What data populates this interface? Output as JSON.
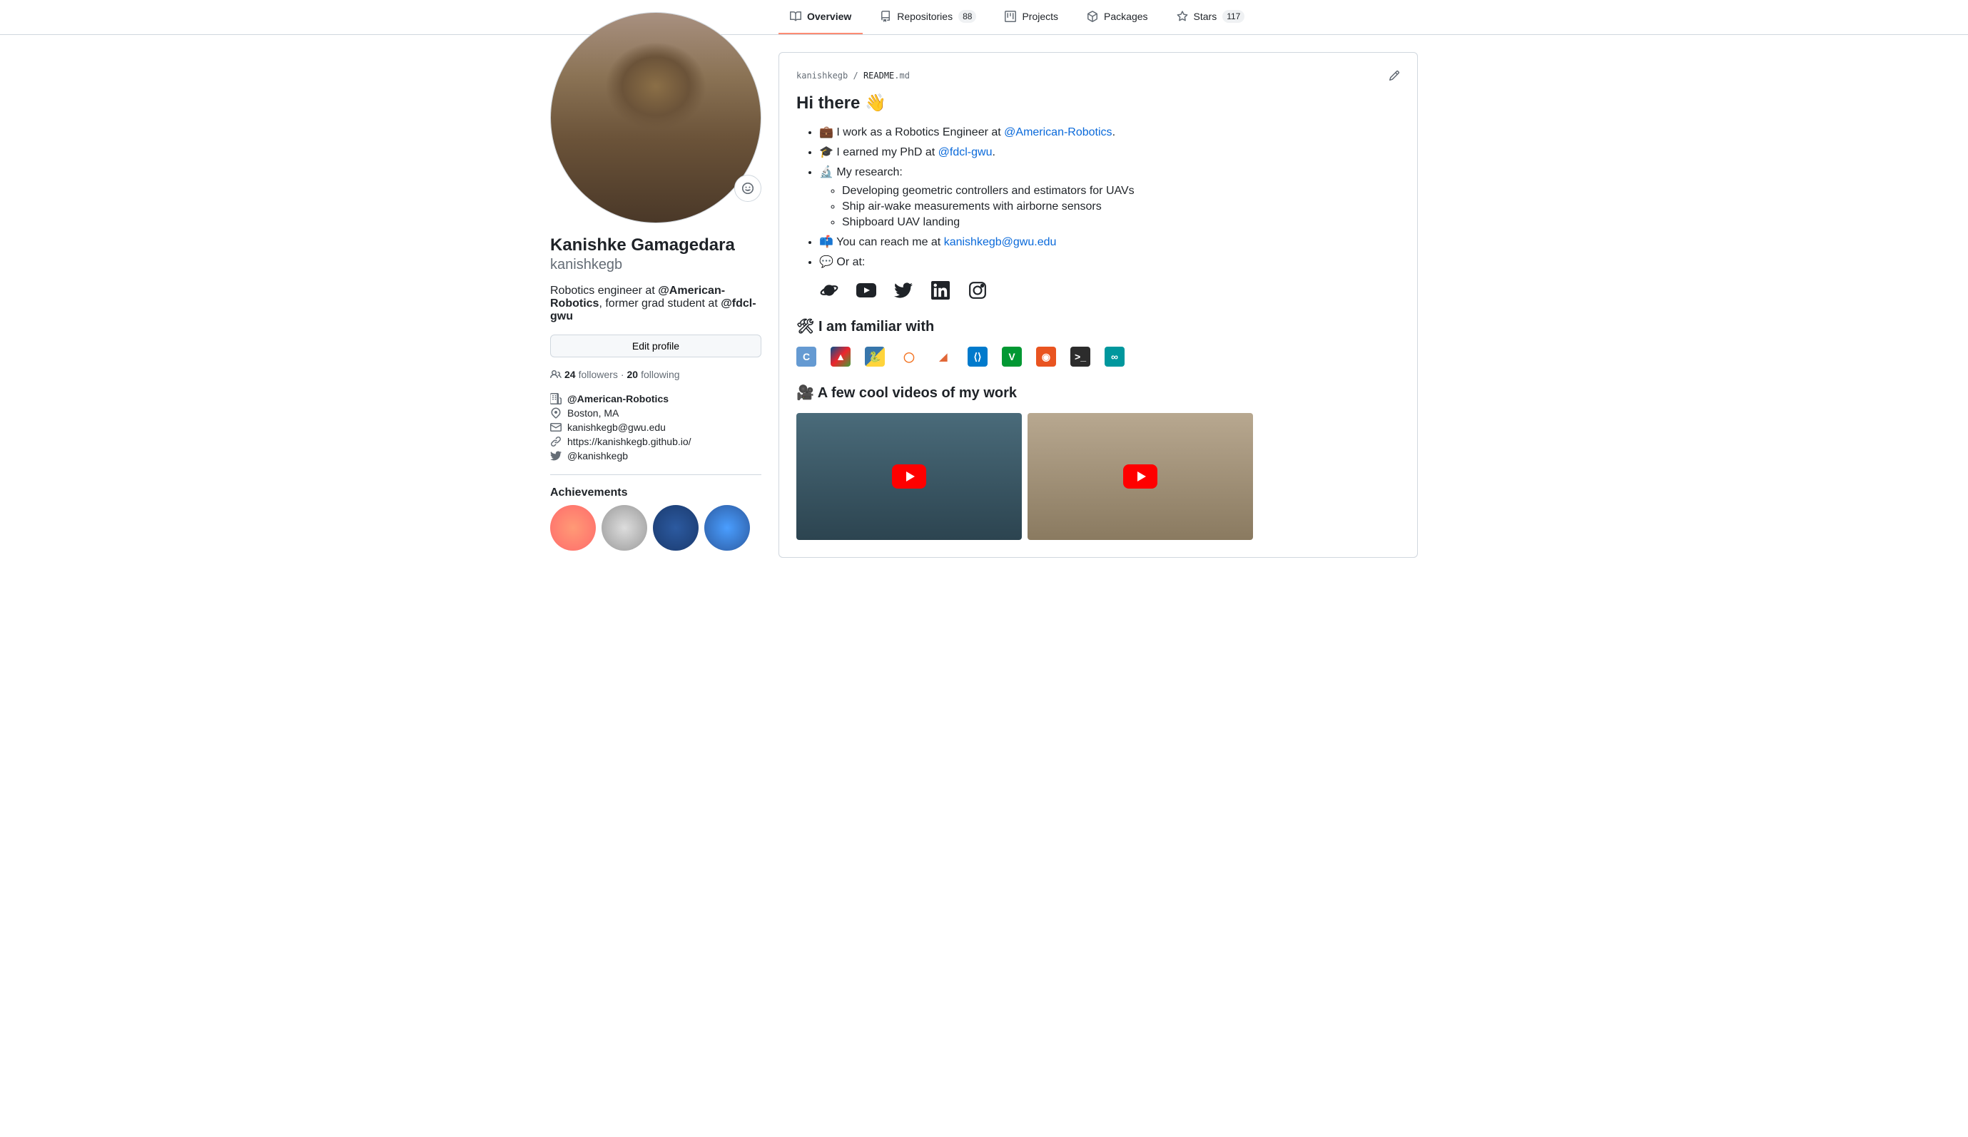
{
  "tabs": [
    {
      "label": "Overview",
      "badge": null,
      "active": true
    },
    {
      "label": "Repositories",
      "badge": "88",
      "active": false
    },
    {
      "label": "Projects",
      "badge": null,
      "active": false
    },
    {
      "label": "Packages",
      "badge": null,
      "active": false
    },
    {
      "label": "Stars",
      "badge": "117",
      "active": false
    }
  ],
  "profile": {
    "fullname": "Kanishke Gamagedara",
    "username": "kanishkegb",
    "bio_prefix": "Robotics engineer at ",
    "bio_org1": "@American-Robotics",
    "bio_mid": ", former grad student at ",
    "bio_org2": "@fdcl-gwu",
    "edit_label": "Edit profile",
    "followers_count": "24",
    "followers_label": "followers",
    "following_count": "20",
    "following_label": "following",
    "company": "@American-Robotics",
    "location": "Boston, MA",
    "email": "kanishkegb@gwu.edu",
    "website": "https://kanishkegb.github.io/",
    "twitter": "@kanishkegb",
    "achievements_title": "Achievements"
  },
  "readme": {
    "path_user": "kanishkegb",
    "path_sep": " / ",
    "path_file": "README",
    "path_ext": ".md",
    "h_hi": "Hi there 👋",
    "li1_emoji": "💼",
    "li1_text": " I work as a Robotics Engineer at ",
    "li1_link": "@American-Robotics",
    "li1_suffix": ".",
    "li2_emoji": "🎓",
    "li2_text": " I earned my PhD at ",
    "li2_link": "@fdcl-gwu",
    "li2_suffix": ".",
    "li3_emoji": "🔬",
    "li3_text": " My research:",
    "li3_sub1": "Developing geometric controllers and estimators for UAVs",
    "li3_sub2": "Ship air-wake measurements with airborne sensors",
    "li3_sub3": "Shipboard UAV landing",
    "li4_emoji": "📫",
    "li4_text": " You can reach me at ",
    "li4_link": "kanishkegb@gwu.edu",
    "li5_emoji": "💬",
    "li5_text": " Or at:",
    "h_familiar": "🛠 I am familiar with",
    "h_videos": "🎥 A few cool videos of my work"
  },
  "tools": [
    {
      "name": "cpp",
      "bg": "#659ad2",
      "label": "C"
    },
    {
      "name": "cmake",
      "bg": "linear-gradient(135deg,#064f8c,#ee252c,#3fa037)",
      "label": "▲"
    },
    {
      "name": "python",
      "bg": "linear-gradient(135deg,#3776ab 50%,#ffd43b 50%)",
      "label": "🐍"
    },
    {
      "name": "jupyter",
      "bg": "#fff",
      "label": "◯",
      "color": "#f37626"
    },
    {
      "name": "matlab",
      "bg": "#fff",
      "label": "◢",
      "color": "#e16737"
    },
    {
      "name": "vscode",
      "bg": "#007acc",
      "label": "⟨⟩"
    },
    {
      "name": "vim",
      "bg": "#019833",
      "label": "V"
    },
    {
      "name": "ubuntu",
      "bg": "#e95420",
      "label": "◉"
    },
    {
      "name": "terminal",
      "bg": "#2c2c2c",
      "label": ">_"
    },
    {
      "name": "arduino",
      "bg": "#00979d",
      "label": "∞"
    }
  ]
}
